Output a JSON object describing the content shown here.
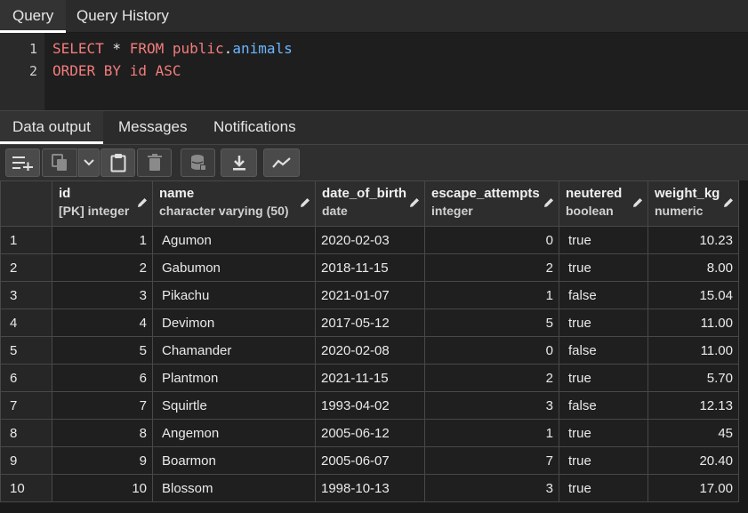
{
  "top_tabs": [
    {
      "label": "Query",
      "active": true
    },
    {
      "label": "Query History",
      "active": false
    }
  ],
  "editor": {
    "line_numbers": [
      "1",
      "2"
    ],
    "line1": {
      "select": "SELECT",
      "star": " * ",
      "from": "FROM",
      "schema": " public",
      "dot": ".",
      "table": "animals"
    },
    "line2": {
      "order": "ORDER BY",
      "col": " id ",
      "dir": "ASC"
    }
  },
  "result_tabs": [
    {
      "label": "Data output",
      "active": true
    },
    {
      "label": "Messages",
      "active": false
    },
    {
      "label": "Notifications",
      "active": false
    }
  ],
  "toolbar": {
    "icons": [
      "add-row-icon",
      "copy-icon",
      "chevron-down-icon",
      "paste-icon",
      "delete-icon",
      "save-data-icon",
      "download-icon",
      "graph-icon"
    ]
  },
  "columns": [
    {
      "name": "id",
      "type": "[PK] integer"
    },
    {
      "name": "name",
      "type": "character varying (50)"
    },
    {
      "name": "date_of_birth",
      "type": "date"
    },
    {
      "name": "escape_attempts",
      "type": "integer"
    },
    {
      "name": "neutered",
      "type": "boolean"
    },
    {
      "name": "weight_kg",
      "type": "numeric"
    }
  ],
  "rows": [
    [
      "1",
      "1",
      "Agumon",
      "2020-02-03",
      "0",
      "true",
      "10.23"
    ],
    [
      "2",
      "2",
      "Gabumon",
      "2018-11-15",
      "2",
      "true",
      "8.00"
    ],
    [
      "3",
      "3",
      "Pikachu",
      "2021-01-07",
      "1",
      "false",
      "15.04"
    ],
    [
      "4",
      "4",
      "Devimon",
      "2017-05-12",
      "5",
      "true",
      "11.00"
    ],
    [
      "5",
      "5",
      "Chamander",
      "2020-02-08",
      "0",
      "false",
      "11.00"
    ],
    [
      "6",
      "6",
      "Plantmon",
      "2021-11-15",
      "2",
      "true",
      "5.70"
    ],
    [
      "7",
      "7",
      "Squirtle",
      "1993-04-02",
      "3",
      "false",
      "12.13"
    ],
    [
      "8",
      "8",
      "Angemon",
      "2005-06-12",
      "1",
      "true",
      "45"
    ],
    [
      "9",
      "9",
      "Boarmon",
      "2005-06-07",
      "7",
      "true",
      "20.40"
    ],
    [
      "10",
      "10",
      "Blossom",
      "1998-10-13",
      "3",
      "true",
      "17.00"
    ]
  ]
}
